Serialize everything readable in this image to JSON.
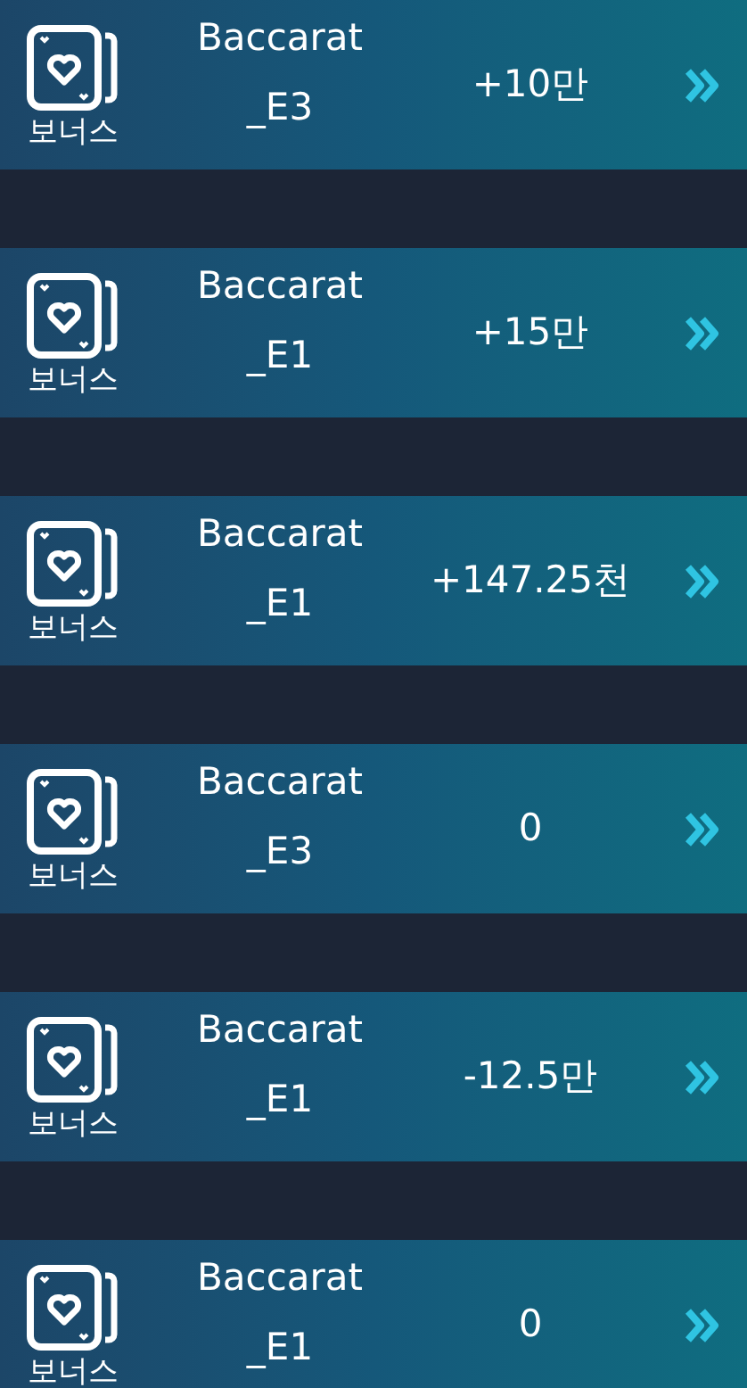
{
  "rows": [
    {
      "category": "보너스",
      "game": "Baccarat _E3",
      "amount": "+10만"
    },
    {
      "category": "보너스",
      "game": "Baccarat _E1",
      "amount": "+15만"
    },
    {
      "category": "보너스",
      "game": "Baccarat _E1",
      "amount": "+147.25천"
    },
    {
      "category": "보너스",
      "game": "Baccarat _E3",
      "amount": "0"
    },
    {
      "category": "보너스",
      "game": "Baccarat _E1",
      "amount": "-12.5만"
    },
    {
      "category": "보너스",
      "game": "Baccarat _E1",
      "amount": "0"
    }
  ]
}
